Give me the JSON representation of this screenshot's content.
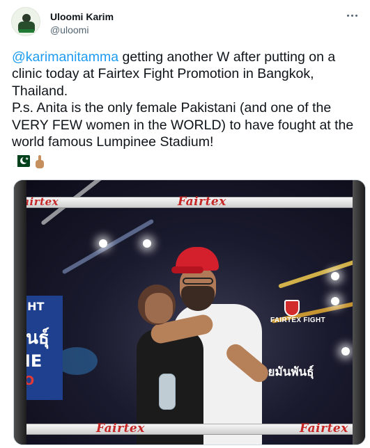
{
  "author": {
    "name": "Uloomi Karim",
    "handle": "@uloomi"
  },
  "tweet": {
    "mention": "@karimanitamma",
    "line1_rest": " getting another W after putting on a",
    "line2": "clinic today at Fairtex Fight Promotion in Bangkok,",
    "line3": "Thailand.",
    "line4": "P.s. Anita is the only female Pakistani (and one of the",
    "line5": "VERY FEW women in the WORLD) to have fought at the",
    "line6": "world famous Lumpinee Stadium!"
  },
  "emojis": [
    "pakistan-flag",
    "index-pointing-up-medium-skin-tone"
  ],
  "photo": {
    "rope_brand": "Fairtex",
    "sign_text": "FAIRTEX FIGHT",
    "thai_text": "วยมันพันธุ์",
    "left_board_lines": [
      "IGHT",
      "พันธุ์",
      "ME",
      "RO"
    ],
    "colors": {
      "brand_red": "#c62828",
      "cap_red": "#d4202c"
    }
  },
  "colors": {
    "text": "#0f1419",
    "secondary": "#536471",
    "link": "#1d9bf0"
  }
}
